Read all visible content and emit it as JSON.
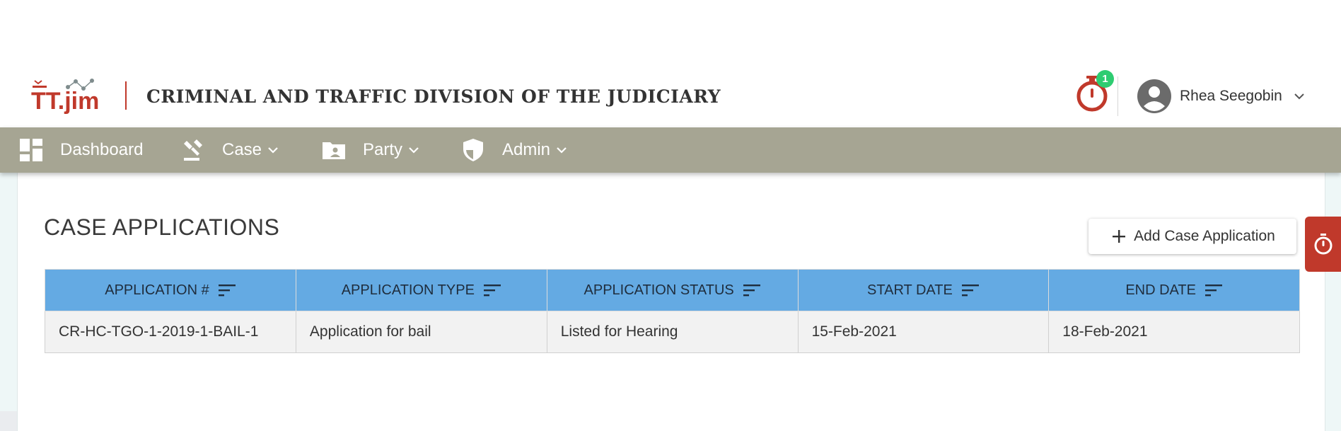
{
  "header": {
    "logo_text": "TT.jim",
    "title": "CRIMINAL AND TRAFFIC DIVISION OF THE JUDICIARY",
    "timer_badge": "1",
    "user_name": "Rhea Seegobin"
  },
  "nav": {
    "items": [
      {
        "label": "Dashboard",
        "icon": "dashboard-icon"
      },
      {
        "label": "Case",
        "icon": "gavel-icon"
      },
      {
        "label": "Party",
        "icon": "party-folder-icon"
      },
      {
        "label": "Admin",
        "icon": "shield-icon"
      }
    ]
  },
  "main": {
    "title": "CASE APPLICATIONS",
    "add_button": "Add Case Application",
    "table": {
      "columns": [
        "APPLICATION #",
        "APPLICATION TYPE",
        "APPLICATION STATUS",
        "START DATE",
        "END DATE"
      ],
      "rows": [
        [
          "CR-HC-TGO-1-2019-1-BAIL-1",
          "Application for bail",
          "Listed for Hearing",
          "15-Feb-2021",
          "18-Feb-2021"
        ]
      ]
    }
  },
  "colors": {
    "nav_bg": "#a6a593",
    "brand_red": "#c0392b",
    "table_header": "#64aae3",
    "badge_green": "#2ecc71"
  }
}
